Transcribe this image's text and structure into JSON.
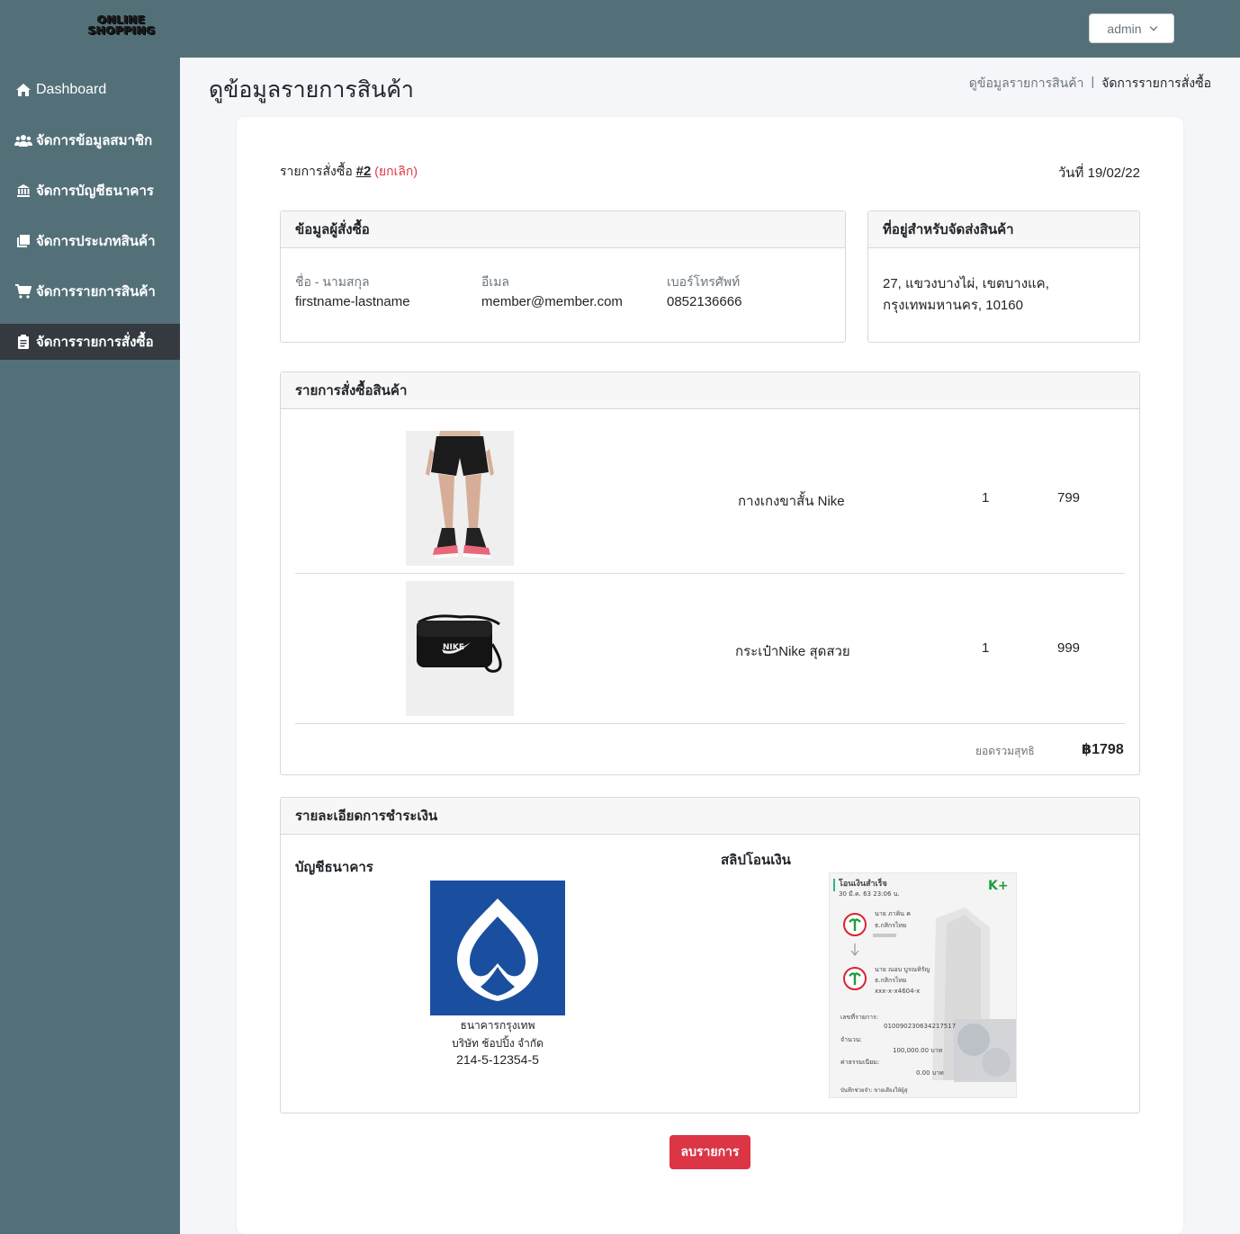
{
  "header": {
    "logo_line1": "ONLINE",
    "logo_line2": "SHOPPING",
    "user_menu": "admin"
  },
  "sidebar": {
    "items": [
      {
        "label": "Dashboard",
        "icon": "home-icon"
      },
      {
        "label": "จัดการข้อมูลสมาชิก",
        "icon": "users-icon"
      },
      {
        "label": "จัดการบัญชีธนาคาร",
        "icon": "bank-icon"
      },
      {
        "label": "จัดการประเภทสินค้า",
        "icon": "clone-icon"
      },
      {
        "label": "จัดการรายการสินค้า",
        "icon": "cart-icon"
      },
      {
        "label": "จัดการรายการสั่งซื้อ",
        "icon": "clipboard-icon",
        "active": true
      }
    ]
  },
  "page": {
    "title": "ดูข้อมูลรายการสินค้า",
    "breadcrumb": [
      "ดูข้อมูลรายการสินค้า",
      "จัดการรายการสั่งซื้อ"
    ]
  },
  "order": {
    "prefix": "รายการสั่งซื้อ",
    "number": "#2",
    "status": "(ยกเลิก)",
    "date": "วันที่ 19/02/22"
  },
  "customer": {
    "title": "ข้อมูลผู้สั่งซื้อ",
    "name_label": "ชื่อ - นามสกุล",
    "name": "firstname-lastname",
    "email_label": "อีเมล",
    "email": "member@member.com",
    "phone_label": "เบอร์โทรศัพท์",
    "phone": "0852136666"
  },
  "shipping": {
    "title": "ที่อยู่สำหรับจัดส่งสินค้า",
    "line1": "27, แขวงบางไผ่, เขตบางแค,",
    "line2": "กรุงเทพมหานคร, 10160"
  },
  "items": {
    "title": "รายการสั่งซื้อสินค้า",
    "rows": [
      {
        "name": "กางเกงขาสั้น Nike",
        "qty": "1",
        "price": "799",
        "image": "shorts-image"
      },
      {
        "name": "กระเป๋าNike สุดสวย",
        "qty": "1",
        "price": "999",
        "image": "bag-image"
      }
    ],
    "total_label": "ยอดรวมสุทธิ",
    "total": "฿1798"
  },
  "payment": {
    "title": "รายละเอียดการชำระเงิน",
    "bank_heading": "บัญชีธนาคาร",
    "bank_name": "ธนาคารกรุงเทพ",
    "account_name": "บริษัท ช้อปปิ้ง จำกัด",
    "account_no": "214-5-12354-5",
    "slip_heading": "สลิปโอนเงิน",
    "slip": {
      "title": "โอนเงินสำเร็จ",
      "datetime": "30 มี.ค. 63  23:06 น.",
      "brand": "K+",
      "from_name": "นาย ภาคิน ค",
      "from_bank": "ธ.กสิกรไทย",
      "to_name": "นาย ณอบ บูรณหิรัญ",
      "to_bank": "ธ.กสิกรไทย",
      "to_acct": "xxx-x-x4604-x",
      "ref_label": "เลขที่รายการ:",
      "ref": "010090230634217517",
      "amount_label": "จำนวน:",
      "amount": "100,000.00 บาท",
      "fee_label": "ค่าธรรมเนียม:",
      "fee": "0.00 บาท",
      "memo": "บันทึกช่วยจำ: ขายเสียงให้ผู้สุ"
    }
  },
  "actions": {
    "delete": "ลบรายการ"
  },
  "colors": {
    "sidebar": "#537079",
    "active": "#343a40",
    "danger": "#dc3545",
    "bank_blue": "#1a4fa0"
  }
}
